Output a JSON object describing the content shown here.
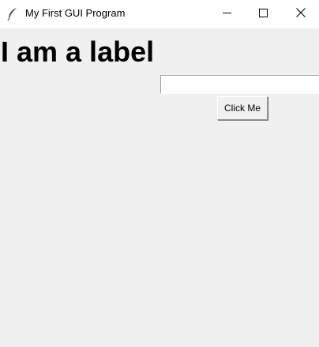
{
  "window": {
    "title": "My First GUI Program",
    "app_icon": "feather-icon",
    "controls": {
      "minimize_icon": "minimize-icon",
      "maximize_icon": "maximize-icon",
      "close_icon": "close-icon"
    }
  },
  "main": {
    "label_text": "I am a label",
    "entry": {
      "value": "",
      "placeholder": ""
    },
    "button_label": "Click Me"
  }
}
